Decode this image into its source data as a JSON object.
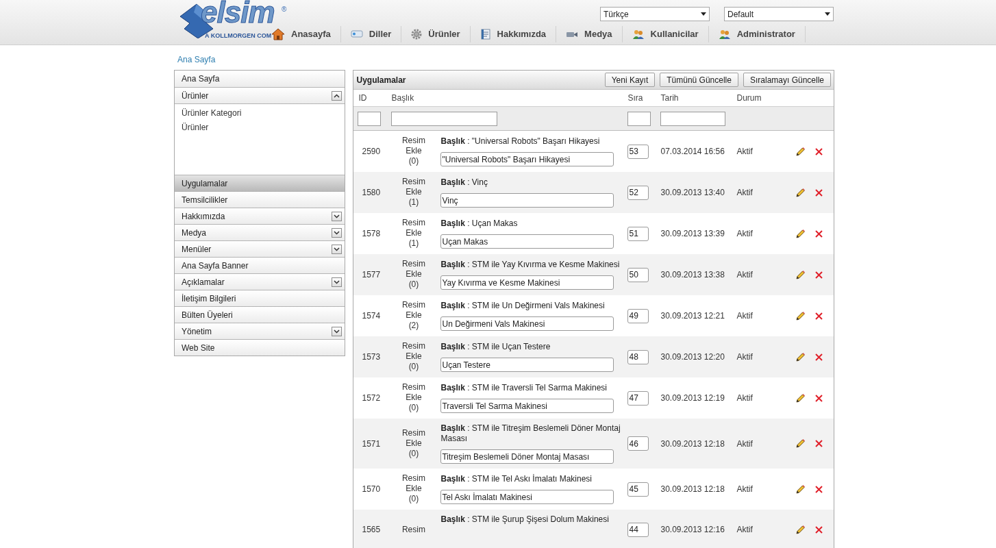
{
  "logo": {
    "name": "elsim",
    "mark": "®",
    "tagline": "A KOLLMORGEN COM"
  },
  "nav": [
    {
      "label": "Anasayfa"
    },
    {
      "label": "Diller"
    },
    {
      "label": "Ürünler"
    },
    {
      "label": "Hakkımızda"
    },
    {
      "label": "Medya"
    },
    {
      "label": "Kullanicilar"
    },
    {
      "label": "Administrator"
    }
  ],
  "selects": [
    {
      "value": "Türkçe"
    },
    {
      "value": "Default"
    }
  ],
  "breadcrumb": "Ana Sayfa",
  "sidebar": {
    "items": [
      {
        "label": "Ana Sayfa",
        "kind": "link",
        "selected": false
      },
      {
        "label": "Ürünler",
        "kind": "group",
        "expanded": true,
        "selected": false,
        "children": [
          {
            "label": "Ürünler Kategori"
          },
          {
            "label": "Ürünler"
          }
        ]
      },
      {
        "label": "Uygulamalar",
        "kind": "link",
        "selected": true
      },
      {
        "label": "Temsilcilikler",
        "kind": "link",
        "selected": false
      },
      {
        "label": "Hakkımızda",
        "kind": "group",
        "expanded": false,
        "selected": false
      },
      {
        "label": "Medya",
        "kind": "group",
        "expanded": false,
        "selected": false
      },
      {
        "label": "Menüler",
        "kind": "group",
        "expanded": false,
        "selected": false
      },
      {
        "label": "Ana Sayfa Banner",
        "kind": "link",
        "selected": false
      },
      {
        "label": "Açıklamalar",
        "kind": "group",
        "expanded": false,
        "selected": false
      },
      {
        "label": "İletişim Bilgileri",
        "kind": "link",
        "selected": false
      },
      {
        "label": "Bülten Üyeleri",
        "kind": "link",
        "selected": false
      },
      {
        "label": "Yönetim",
        "kind": "group",
        "expanded": false,
        "selected": false
      },
      {
        "label": "Web Site",
        "kind": "link",
        "selected": false
      }
    ]
  },
  "panel": {
    "title": "Uygulamalar",
    "buttons": [
      "Yeni Kayıt",
      "Tümünü Güncelle",
      "Sıralamayı Güncelle"
    ]
  },
  "table": {
    "columns": [
      "ID",
      "Başlık",
      "Sıra",
      "Tarih",
      "Durum"
    ],
    "rows": [
      {
        "id": "2590",
        "image": "Resim Ekle (0)",
        "title": "**Başlık** : \"Universal Robots\" Başarı Hikayesi",
        "value": "\"Universal Robots\" Başarı Hikayesi",
        "order": "53",
        "date": "07.03.2014 16:56",
        "status": "Aktif"
      },
      {
        "id": "1580",
        "image": "Resim Ekle (1)",
        "title": "**Başlık** : Vinç",
        "value": "Vinç",
        "order": "52",
        "date": "30.09.2013 13:40",
        "status": "Aktif"
      },
      {
        "id": "1578",
        "image": "Resim Ekle (1)",
        "title": "**Başlık** : Uçan Makas",
        "value": "Uçan Makas",
        "order": "51",
        "date": "30.09.2013 13:39",
        "status": "Aktif"
      },
      {
        "id": "1577",
        "image": "Resim Ekle (0)",
        "title": "**Başlık** : STM ile Yay Kıvırma ve Kesme Makinesi",
        "value": "Yay Kıvırma ve Kesme Makinesi",
        "order": "50",
        "date": "30.09.2013 13:38",
        "status": "Aktif"
      },
      {
        "id": "1574",
        "image": "Resim Ekle (2)",
        "title": "**Başlık** : STM ile Un Değirmeni Vals Makinesi",
        "value": "Un Değirmeni Vals Makinesi",
        "order": "49",
        "date": "30.09.2013 12:21",
        "status": "Aktif"
      },
      {
        "id": "1573",
        "image": "Resim Ekle (0)",
        "title": "**Başlık** : STM ile Uçan Testere",
        "value": "Uçan Testere",
        "order": "48",
        "date": "30.09.2013 12:20",
        "status": "Aktif"
      },
      {
        "id": "1572",
        "image": "Resim Ekle (0)",
        "title": "**Başlık** : STM ile Traversli Tel Sarma Makinesi",
        "value": "Traversli Tel Sarma Makinesi",
        "order": "47",
        "date": "30.09.2013 12:19",
        "status": "Aktif"
      },
      {
        "id": "1571",
        "image": "Resim Ekle (0)",
        "title": "**Başlık** : STM ile Titreşim Beslemeli Döner Montaj Masası",
        "value": "Titreşim Beslemeli Döner Montaj Masası",
        "order": "46",
        "date": "30.09.2013 12:18",
        "status": "Aktif"
      },
      {
        "id": "1570",
        "image": "Resim Ekle (0)",
        "title": "**Başlık** : STM ile Tel Askı İmalatı Makinesi",
        "value": "Tel Askı İmalatı Makinesi",
        "order": "45",
        "date": "30.09.2013 12:18",
        "status": "Aktif"
      },
      {
        "id": "1565",
        "image": "Resim",
        "title": "**Başlık** : STM ile Şurup Şişesi Dolum Makinesi",
        "order": "44",
        "date": "30.09.2013 12:16",
        "status": "Aktif"
      }
    ]
  }
}
